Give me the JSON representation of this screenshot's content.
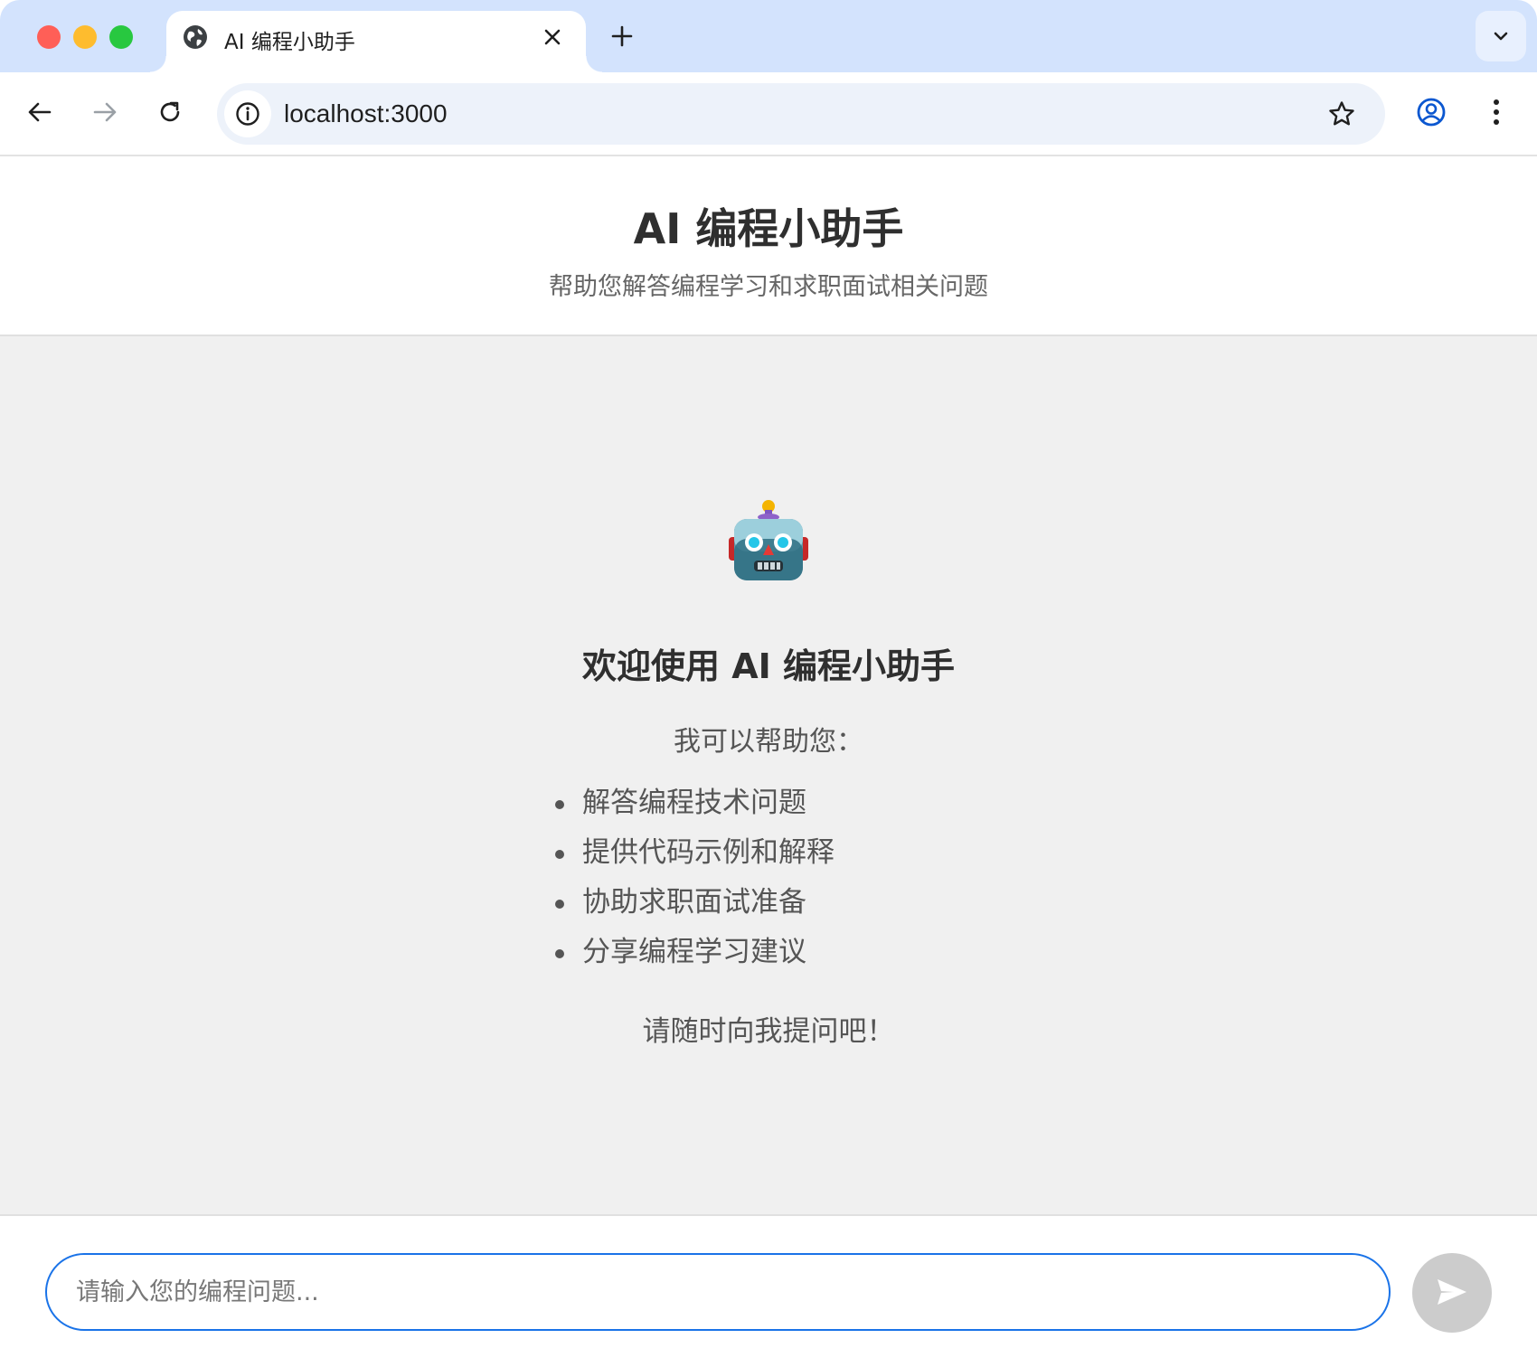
{
  "browser": {
    "tab_title": "AI 编程小助手",
    "url": "localhost:3000",
    "icons": {
      "tab_favicon": "globe-icon",
      "tab_close": "close-icon",
      "new_tab": "plus-icon",
      "tab_search": "chevron-down-icon",
      "back": "arrow-left-icon",
      "forward": "arrow-right-icon",
      "reload": "reload-icon",
      "site_info": "info-icon",
      "bookmark": "star-icon",
      "profile": "profile-icon",
      "menu": "kebab-menu-icon"
    }
  },
  "header": {
    "title": "AI 编程小助手",
    "subtitle": "帮助您解答编程学习和求职面试相关问题"
  },
  "welcome": {
    "avatar_icon": "robot-icon",
    "title": "欢迎使用 AI 编程小助手",
    "intro": "我可以帮助您：",
    "features": [
      "解答编程技术问题",
      "提供代码示例和解释",
      "协助求职面试准备",
      "分享编程学习建议"
    ],
    "outro": "请随时向我提问吧！"
  },
  "composer": {
    "placeholder": "请输入您的编程问题...",
    "value": "",
    "send_icon": "send-icon"
  },
  "colors": {
    "tabstrip": "#d3e3fd",
    "chat_background": "#f0f0f0",
    "input_border": "#1a73e8",
    "send_button": "#cccccc"
  }
}
